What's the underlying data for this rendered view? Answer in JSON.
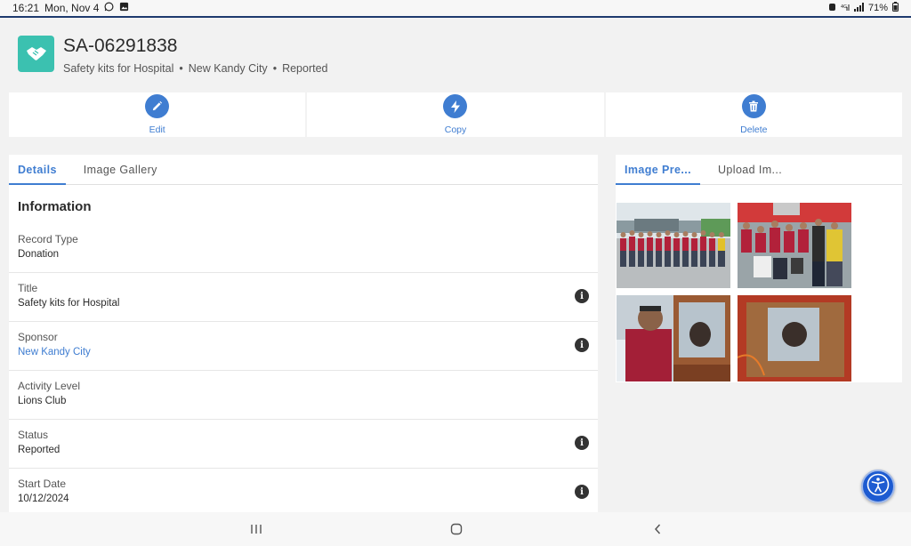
{
  "status_bar": {
    "time": "16:21",
    "date": "Mon, Nov 4",
    "battery": "71%"
  },
  "record": {
    "icon": "handshake-icon",
    "title": "SA-06291838",
    "subtitle": [
      "Safety kits for Hospital",
      "New Kandy City",
      "Reported"
    ]
  },
  "actions": [
    {
      "label": "Edit",
      "icon": "pencil-icon"
    },
    {
      "label": "Copy",
      "icon": "lightning-icon"
    },
    {
      "label": "Delete",
      "icon": "trash-icon"
    }
  ],
  "left_tabs": [
    {
      "label": "Details",
      "active": true
    },
    {
      "label": "Image Gallery",
      "active": false
    }
  ],
  "section_title": "Information",
  "fields": [
    {
      "label": "Record Type",
      "value": "Donation",
      "info": false,
      "link": false
    },
    {
      "label": "Title",
      "value": "Safety kits for Hospital",
      "info": true,
      "link": false
    },
    {
      "label": "Sponsor",
      "value": "New Kandy City",
      "info": true,
      "link": true
    },
    {
      "label": "Activity Level",
      "value": "Lions Club",
      "info": false,
      "link": false
    },
    {
      "label": "Status",
      "value": "Reported",
      "info": true,
      "link": false
    },
    {
      "label": "Start Date",
      "value": "10/12/2024",
      "info": true,
      "link": false
    }
  ],
  "right_tabs": [
    {
      "label": "Image Pre...",
      "active": true
    },
    {
      "label": "Upload Im...",
      "active": false
    }
  ],
  "colors": {
    "accent": "#3f7dd1",
    "record_icon_bg": "#3bc1b0",
    "fab": "#1d5bd1"
  },
  "fab_icon": "accessibility-icon"
}
